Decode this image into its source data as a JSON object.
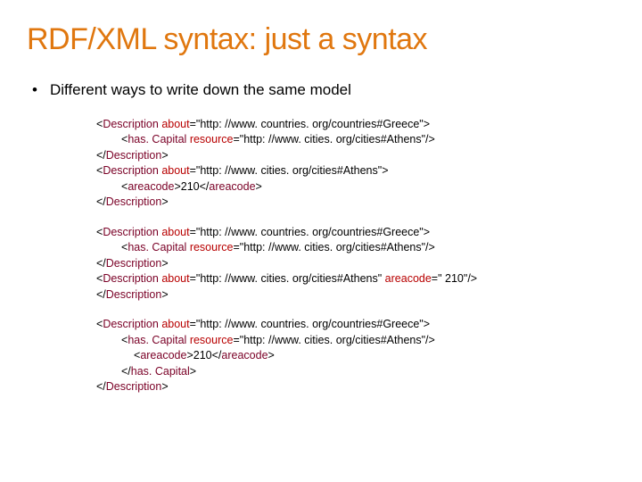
{
  "title": "RDF/XML syntax: just a syntax",
  "bullet": "Different ways to write down the same model",
  "tags": {
    "Description": "Description",
    "hasCapital": "has. Capital",
    "areacode": "areacode"
  },
  "attrs": {
    "about": "about",
    "resource": "resource",
    "areacode": "areacode"
  },
  "urls": {
    "greece": "\"http: //www. countries. org/countries#Greece\"",
    "athens": "\"http: //www. cities. org/cities#Athens\""
  },
  "values": {
    "areacode_text": "210",
    "areacode_attr": "\" 210\""
  },
  "sym": {
    "lt": "<",
    "gt": ">",
    "ltc": "</",
    "sgt": "/>",
    "eq": "="
  }
}
